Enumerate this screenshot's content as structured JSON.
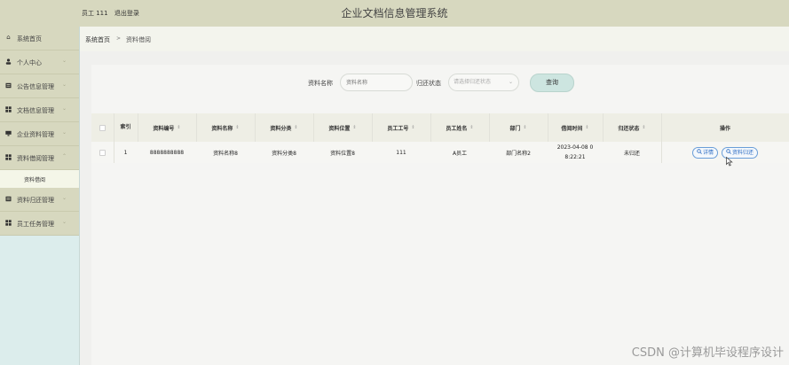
{
  "header": {
    "user_label": "员工 111",
    "logout_label": "退出登录",
    "system_title": "企业文档信息管理系统"
  },
  "sidebar": {
    "items": [
      {
        "label": "系统首页",
        "icon": "home-icon",
        "chevron": ""
      },
      {
        "label": "个人中心",
        "icon": "user-icon",
        "chevron": "⌄"
      },
      {
        "label": "公告信息管理",
        "icon": "notice-icon",
        "chevron": "⌄"
      },
      {
        "label": "文档信息管理",
        "icon": "grid-icon",
        "chevron": "⌄"
      },
      {
        "label": "企业资料管理",
        "icon": "monitor-icon",
        "chevron": "⌄"
      },
      {
        "label": "资料借阅管理",
        "icon": "grid-icon",
        "chevron": "⌃"
      }
    ],
    "active_sub": "资料借阅",
    "items_after": [
      {
        "label": "资料归还管理",
        "icon": "notice-icon",
        "chevron": "⌄"
      },
      {
        "label": "员工任务管理",
        "icon": "grid-icon",
        "chevron": "⌄"
      }
    ]
  },
  "breadcrumb": {
    "home": "系统首页",
    "separator": ">",
    "current": "资料借阅"
  },
  "search": {
    "name_label": "资料名称",
    "name_placeholder": "资料名称",
    "status_label": "归还状态",
    "status_placeholder": "请选择归还状态",
    "button_label": "查询"
  },
  "table": {
    "headers": [
      "索引",
      "资料编号",
      "资料名称",
      "资料分类",
      "资料位置",
      "员工工号",
      "员工姓名",
      "部门",
      "借阅时间",
      "归还状态",
      "操作"
    ],
    "rows": [
      {
        "index": "1",
        "code": "8888888888",
        "name": "资料名称8",
        "category": "资料分类8",
        "location": "资料位置8",
        "emp_no": "111",
        "emp_name": "A员工",
        "dept": "部门名称2",
        "borrow_time_line1": "2023-04-08 0",
        "borrow_time_line2": "8:22:21",
        "status": "未归还",
        "detail_label": "详情",
        "return_label": "资料归还"
      }
    ]
  },
  "watermark": "CSDN @计算机毕设程序设计",
  "colors": {
    "topbar": "#d7d8bf",
    "sidebar": "#dcedec",
    "accent_button": "#cde5e0",
    "link_blue": "#2f6ec4"
  }
}
